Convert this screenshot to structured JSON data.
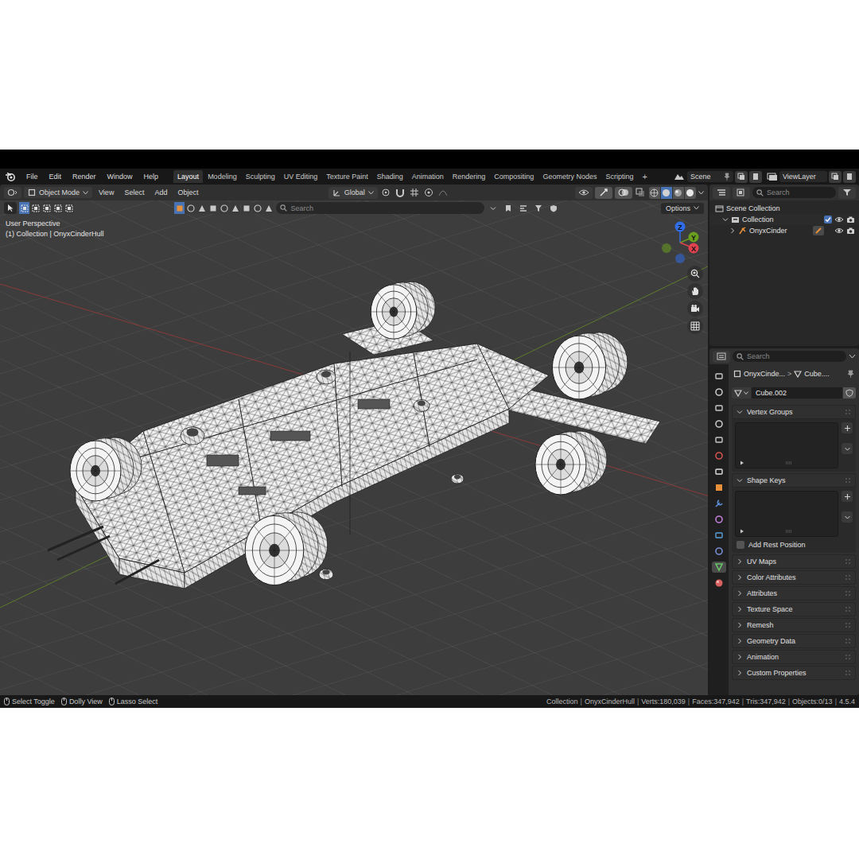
{
  "app": {
    "menu": [
      "File",
      "Edit",
      "Render",
      "Window",
      "Help"
    ],
    "workspaces": [
      {
        "label": "Layout",
        "selected": true
      },
      {
        "label": "Modeling",
        "selected": false
      },
      {
        "label": "Sculpting",
        "selected": false
      },
      {
        "label": "UV Editing",
        "selected": false
      },
      {
        "label": "Texture Paint",
        "selected": false
      },
      {
        "label": "Shading",
        "selected": false
      },
      {
        "label": "Animation",
        "selected": false
      },
      {
        "label": "Rendering",
        "selected": false
      },
      {
        "label": "Compositing",
        "selected": false
      },
      {
        "label": "Geometry Nodes",
        "selected": false
      },
      {
        "label": "Scripting",
        "selected": false
      }
    ],
    "add_workspace": "+",
    "scene": "Scene",
    "view_layer": "ViewLayer"
  },
  "viewport_header": {
    "mode": "Object Mode",
    "menus": [
      "View",
      "Select",
      "Add",
      "Object"
    ],
    "orientation": "Global",
    "shading_modes": [
      {
        "kind": "wireframe",
        "selected": false
      },
      {
        "kind": "solid",
        "selected": true
      },
      {
        "kind": "material",
        "selected": false
      },
      {
        "kind": "rendered",
        "selected": false
      }
    ]
  },
  "toolbar": {
    "select_modes": [
      {
        "selected": true
      },
      {
        "selected": false
      },
      {
        "selected": false
      },
      {
        "selected": false
      },
      {
        "selected": false
      }
    ],
    "type_filters": [
      {
        "selected": true
      },
      {
        "selected": false
      },
      {
        "selected": false
      },
      {
        "selected": false
      },
      {
        "selected": false
      },
      {
        "selected": false
      },
      {
        "selected": false
      },
      {
        "selected": false
      },
      {
        "selected": false
      }
    ],
    "search_placeholder": "Search",
    "options": "Options"
  },
  "viewport": {
    "view": "User Perspective",
    "context": "(1) Collection | OnyxCinderHull",
    "axes": [
      {
        "label": "Z",
        "color": "#2f6ee8"
      },
      {
        "label": "Y",
        "color": "#6a9e1f"
      },
      {
        "label": "X",
        "color": "#e0424f"
      }
    ]
  },
  "outliner": {
    "search_placeholder": "Search",
    "items": [
      {
        "label": "Scene Collection",
        "depth": 0,
        "kind": "scene"
      },
      {
        "label": "Collection",
        "depth": 1,
        "kind": "collection",
        "expanded": true,
        "checked": true,
        "visible": true,
        "renderable": true
      },
      {
        "label": "OnyxCinder",
        "depth": 2,
        "kind": "armature",
        "expanded": false,
        "visible": true,
        "renderable": true
      }
    ]
  },
  "properties": {
    "search_placeholder": "Search",
    "tabs": [
      {
        "selected": false
      },
      {
        "selected": false
      },
      {
        "selected": false
      },
      {
        "selected": false
      },
      {
        "selected": false
      },
      {
        "selected": false
      },
      {
        "selected": false
      },
      {
        "selected": false
      },
      {
        "selected": false
      },
      {
        "selected": false
      },
      {
        "selected": false
      },
      {
        "selected": false
      },
      {
        "selected": true
      },
      {
        "selected": false
      }
    ],
    "breadcrumb": [
      "OnyxCinde...",
      "Cube...."
    ],
    "breadcrumb_separator": ">",
    "data_name": "Cube.002",
    "panels": [
      {
        "label": "Vertex Groups",
        "expanded": true,
        "kind": "list"
      },
      {
        "label": "Shape Keys",
        "expanded": true,
        "kind": "list",
        "option": {
          "label": "Add Rest Position",
          "checked": false
        }
      },
      {
        "label": "UV Maps",
        "expanded": false,
        "kind": "section"
      },
      {
        "label": "Color Attributes",
        "expanded": false,
        "kind": "section"
      },
      {
        "label": "Attributes",
        "expanded": false,
        "kind": "section"
      },
      {
        "label": "Texture Space",
        "expanded": false,
        "kind": "section"
      },
      {
        "label": "Remesh",
        "expanded": false,
        "kind": "section"
      },
      {
        "label": "Geometry Data",
        "expanded": false,
        "kind": "section"
      },
      {
        "label": "Animation",
        "expanded": false,
        "kind": "section"
      },
      {
        "label": "Custom Properties",
        "expanded": false,
        "kind": "section"
      }
    ]
  },
  "status_bar": {
    "hints": [
      "Select Toggle",
      "Dolly View",
      "Lasso Select"
    ],
    "stats": [
      "Collection",
      "OnyxCinderHull",
      "Verts:180,039",
      "Faces:347,942",
      "Tris:347,942",
      "Objects:0/13",
      "4.5.4"
    ],
    "separator": "|"
  }
}
